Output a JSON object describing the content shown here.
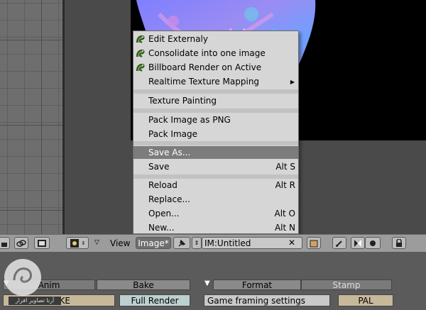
{
  "menu": {
    "items": [
      {
        "label": "Edit Externaly",
        "shortcut": "",
        "icon": "python-script-icon",
        "highlighted": false
      },
      {
        "label": "Consolidate into one image",
        "shortcut": "",
        "icon": "python-script-icon",
        "highlighted": false
      },
      {
        "label": "Billboard Render on Active",
        "shortcut": "",
        "icon": "python-script-icon",
        "highlighted": false
      },
      {
        "label": "Realtime Texture Mapping",
        "shortcut": "",
        "submenu": true,
        "highlighted": false
      },
      {
        "label": "Texture Painting",
        "shortcut": "",
        "highlighted": false
      },
      {
        "label": "Pack Image as PNG",
        "shortcut": "",
        "highlighted": false
      },
      {
        "label": "Pack Image",
        "shortcut": "",
        "highlighted": false
      },
      {
        "label": "Save As...",
        "shortcut": "",
        "highlighted": true
      },
      {
        "label": "Save",
        "shortcut": "Alt S",
        "highlighted": false
      },
      {
        "label": "Reload",
        "shortcut": "Alt R",
        "highlighted": false
      },
      {
        "label": "Replace...",
        "shortcut": "",
        "highlighted": false
      },
      {
        "label": "Open...",
        "shortcut": "Alt O",
        "highlighted": false
      },
      {
        "label": "New...",
        "shortcut": "Alt N",
        "highlighted": false
      }
    ],
    "submenu_arrow": "▶"
  },
  "header": {
    "view_label": "View",
    "image_menu_label": "Image*",
    "image_name": "IM:Untitled",
    "clear_glyph": "✕"
  },
  "bottom": {
    "tab_anim": "Anim",
    "tab_bake": "Bake",
    "bake_button": "BAKE",
    "full_render_button": "Full Render",
    "tab_format": "Format",
    "tab_stamp": "Stamp",
    "game_framing_field": "Game framing settings",
    "pal_button": "PAL",
    "watermark_text": "آرنا تصاویر افزار"
  },
  "colors": {
    "menu_bg": "#d6d6d6",
    "menu_highlight": "#7c7c7c",
    "header_bg": "#9c9c9c",
    "viewport_bg": "#4a4a4a"
  }
}
